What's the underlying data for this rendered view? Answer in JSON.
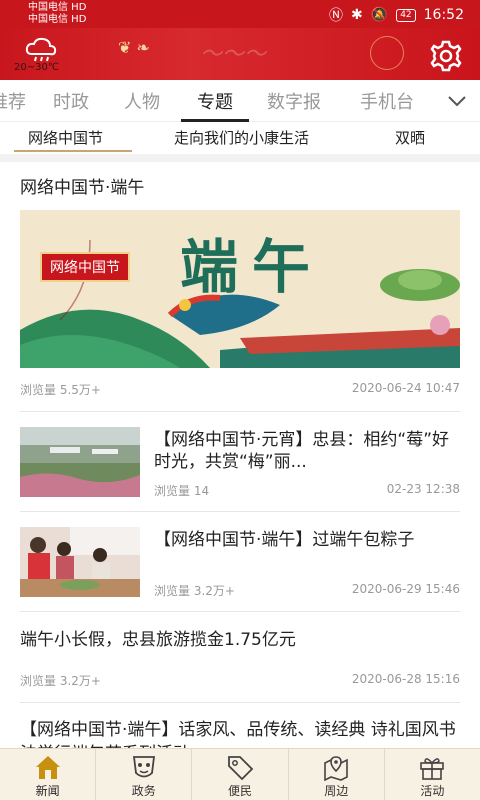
{
  "status_bar": {
    "carrier_1": "中国电信 HD",
    "carrier_2": "中国电信 HD",
    "battery": "42",
    "time": "16:52"
  },
  "banner": {
    "temperature": "20~30℃"
  },
  "channel_tabs": [
    {
      "label": "推荐"
    },
    {
      "label": "时政"
    },
    {
      "label": "人物"
    },
    {
      "label": "专题",
      "active": true
    },
    {
      "label": "数字报"
    },
    {
      "label": "手机台"
    }
  ],
  "sub_tabs": [
    {
      "label": "网络中国节",
      "active": true
    },
    {
      "label": "走向我们的小康生活"
    },
    {
      "label": "双晒"
    }
  ],
  "feed": {
    "featured": {
      "title": "网络中国节·端午",
      "hero_badge": "网络中国节",
      "hero_text": "端午",
      "views": "浏览量 5.5万+",
      "time": "2020-06-24 10:47"
    },
    "items": [
      {
        "title": "【网络中国节·元宵】忠县：相约“莓”好时光，共赏“梅”丽...",
        "views": "浏览量 14",
        "time": "02-23 12:38"
      },
      {
        "title": "【网络中国节·端午】过端午包粽子",
        "views": "浏览量 3.2万+",
        "time": "2020-06-29 15:46"
      }
    ],
    "text_item": {
      "title": "端午小长假，忠县旅游揽金1.75亿元",
      "views": "浏览量 3.2万+",
      "time": "2020-06-28 15:16"
    },
    "partial_item": {
      "title": "【网络中国节·端午】话家风、品传统、读经典 诗礼国风书法学行端午节系列活动"
    }
  },
  "bottom_nav": [
    {
      "label": "新闻",
      "icon": "home-icon",
      "active": true
    },
    {
      "label": "政务",
      "icon": "government-icon"
    },
    {
      "label": "便民",
      "icon": "tag-icon"
    },
    {
      "label": "周边",
      "icon": "map-pin-icon"
    },
    {
      "label": "活动",
      "icon": "gift-icon"
    }
  ],
  "colors": {
    "brand_red": "#c8161d",
    "accent_gold": "#c7a86b",
    "nav_bg": "#f7f1e4"
  }
}
